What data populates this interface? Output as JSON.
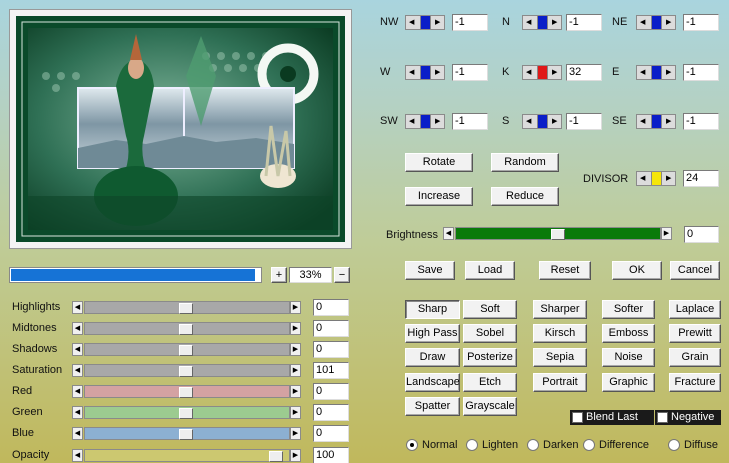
{
  "matrix": {
    "cells": [
      {
        "dir": "NW",
        "value": "-1",
        "color": "#0a1ec8"
      },
      {
        "dir": "N",
        "value": "-1",
        "color": "#0a1ec8"
      },
      {
        "dir": "NE",
        "value": "-1",
        "color": "#0a1ec8"
      },
      {
        "dir": "W",
        "value": "-1",
        "color": "#0a1ec8"
      },
      {
        "dir": "K",
        "value": "32",
        "color": "#e01818"
      },
      {
        "dir": "E",
        "value": "-1",
        "color": "#0a1ec8"
      },
      {
        "dir": "SW",
        "value": "-1",
        "color": "#0a1ec8"
      },
      {
        "dir": "S",
        "value": "-1",
        "color": "#0a1ec8"
      },
      {
        "dir": "SE",
        "value": "-1",
        "color": "#0a1ec8"
      }
    ],
    "divisor_label": "DIVISOR",
    "divisor_value": "24",
    "divisor_color": "#f5e60a"
  },
  "ops": {
    "rotate": "Rotate",
    "random": "Random",
    "increase": "Increase",
    "reduce": "Reduce"
  },
  "brightness": {
    "label": "Brightness",
    "value": "0",
    "level": 0.5
  },
  "actions": {
    "save": "Save",
    "load": "Load",
    "reset": "Reset",
    "ok": "OK",
    "cancel": "Cancel"
  },
  "progress": {
    "fill": 0.98
  },
  "zoom": {
    "plus": "+",
    "value": "33%",
    "minus": "−"
  },
  "sliders": [
    {
      "label": "Highlights",
      "value": "0",
      "color": "#a8a8a8",
      "level": 0.5
    },
    {
      "label": "Midtones",
      "value": "0",
      "color": "#a8a8a8",
      "level": 0.5
    },
    {
      "label": "Shadows",
      "value": "0",
      "color": "#a8a8a8",
      "level": 0.5
    },
    {
      "label": "Saturation",
      "value": "101",
      "color": "#a8a8a8",
      "level": 0.5
    },
    {
      "label": "Red",
      "value": "0",
      "color": "#d4a2a2",
      "level": 0.5
    },
    {
      "label": "Green",
      "value": "0",
      "color": "#9ccb90",
      "level": 0.5
    },
    {
      "label": "Blue",
      "value": "0",
      "color": "#8cb0d2",
      "level": 0.5
    },
    {
      "label": "Opacity",
      "value": "100",
      "color": "#ccc870",
      "level": 1.0
    }
  ],
  "presets": [
    [
      "Sharp",
      "Soft",
      "Sharper",
      "Softer",
      "Laplace"
    ],
    [
      "High Pass",
      "Sobel",
      "Kirsch",
      "Emboss",
      "Prewitt"
    ],
    [
      "Draw",
      "Posterize",
      "Sepia",
      "Noise",
      "Grain"
    ],
    [
      "Landscape",
      "Etch",
      "Portrait",
      "Graphic",
      "Fracture"
    ],
    [
      "Spatter",
      "Grayscale"
    ]
  ],
  "options": {
    "blend_last": "Blend Last",
    "negative": "Negative"
  },
  "modes": [
    "Normal",
    "Lighten",
    "Darken",
    "Difference",
    "Diffuse"
  ]
}
